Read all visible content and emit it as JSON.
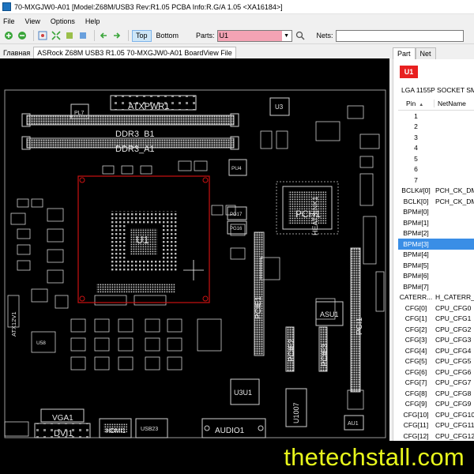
{
  "window": {
    "title": "70-MXGJW0-A01 [Model:Z68M/USB3 Rev:R1.05 PCBA Info:R.G/A 1.05     <XA16184>]"
  },
  "menu": [
    "File",
    "View",
    "Options",
    "Help"
  ],
  "toolbar": {
    "top_label": "Top",
    "bottom_label": "Bottom",
    "parts_label": "Parts:",
    "parts_value": "U1",
    "nets_label": "Nets:",
    "nets_value": ""
  },
  "doc_tabs": [
    "Главная",
    "ASRock Z68M USB3 R1.05 70-MXGJW0-A01 BoardView File"
  ],
  "board": {
    "labels": [
      {
        "id": "atxpwr",
        "text": "ATXPWR1"
      },
      {
        "id": "ddr_b1",
        "text": "DDR3_B1"
      },
      {
        "id": "ddr_a1",
        "text": "DDR3_A1"
      },
      {
        "id": "pl7",
        "text": "PL7"
      },
      {
        "id": "u3",
        "text": "U3"
      },
      {
        "id": "u1",
        "text": "U1"
      },
      {
        "id": "pch",
        "text": "PCH1"
      },
      {
        "id": "heatsink",
        "text": "HEATSINK1"
      },
      {
        "id": "pcie1",
        "text": "PCIE1"
      },
      {
        "id": "pcie2",
        "text": "PCIE2"
      },
      {
        "id": "pcie3",
        "text": "PCIE3"
      },
      {
        "id": "pci1",
        "text": "PCI1"
      },
      {
        "id": "asu1",
        "text": "ASU1"
      },
      {
        "id": "u3u1",
        "text": "U3U1"
      },
      {
        "id": "u1007",
        "text": "U1007"
      },
      {
        "id": "vga1",
        "text": "VGA1"
      },
      {
        "id": "dvi1",
        "text": "DVI1"
      },
      {
        "id": "hdmi1",
        "text": "HDMI1"
      },
      {
        "id": "usb23",
        "text": "USB23"
      },
      {
        "id": "audio1",
        "text": "AUDIO1"
      },
      {
        "id": "atx12v",
        "text": "ATX12V1"
      },
      {
        "id": "u58",
        "text": "U58"
      },
      {
        "id": "pu4",
        "text": "PU4"
      },
      {
        "id": "pg17",
        "text": "PG17"
      },
      {
        "id": "pg16",
        "text": "PG16"
      },
      {
        "id": "au1",
        "text": "AU1"
      }
    ]
  },
  "side": {
    "tabs": [
      "Part",
      "Net"
    ],
    "part_name": "U1",
    "part_desc": "LGA 1155P SOCKET SMT",
    "col_pin": "Pin",
    "col_netname": "NetName",
    "rows": [
      {
        "pin": "1",
        "net": ""
      },
      {
        "pin": "2",
        "net": ""
      },
      {
        "pin": "3",
        "net": ""
      },
      {
        "pin": "4",
        "net": ""
      },
      {
        "pin": "5",
        "net": ""
      },
      {
        "pin": "6",
        "net": ""
      },
      {
        "pin": "7",
        "net": ""
      },
      {
        "pin": "BCLK#[0]",
        "net": "PCH_CK_DMI"
      },
      {
        "pin": "BCLK[0]",
        "net": "PCH_CK_DMI"
      },
      {
        "pin": "BPM#[0]",
        "net": ""
      },
      {
        "pin": "BPM#[1]",
        "net": ""
      },
      {
        "pin": "BPM#[2]",
        "net": ""
      },
      {
        "pin": "BPM#[3]",
        "net": ""
      },
      {
        "pin": "BPM#[4]",
        "net": ""
      },
      {
        "pin": "BPM#[5]",
        "net": ""
      },
      {
        "pin": "BPM#[6]",
        "net": ""
      },
      {
        "pin": "BPM#[7]",
        "net": ""
      },
      {
        "pin": "CATERR...",
        "net": "H_CATERR_N"
      },
      {
        "pin": "CFG[0]",
        "net": "CPU_CFG0"
      },
      {
        "pin": "CFG[1]",
        "net": "CPU_CFG1"
      },
      {
        "pin": "CFG[2]",
        "net": "CPU_CFG2"
      },
      {
        "pin": "CFG[3]",
        "net": "CPU_CFG3"
      },
      {
        "pin": "CFG[4]",
        "net": "CPU_CFG4"
      },
      {
        "pin": "CFG[5]",
        "net": "CPU_CFG5"
      },
      {
        "pin": "CFG[6]",
        "net": "CPU_CFG6"
      },
      {
        "pin": "CFG[7]",
        "net": "CPU_CFG7"
      },
      {
        "pin": "CFG[8]",
        "net": "CPU_CFG8"
      },
      {
        "pin": "CFG[9]",
        "net": "CPU_CFG9"
      },
      {
        "pin": "CFG[10]",
        "net": "CPU_CFG10"
      },
      {
        "pin": "CFG[11]",
        "net": "CPU_CFG11"
      },
      {
        "pin": "CFG[12]",
        "net": "CPU_CFG12"
      }
    ],
    "selected_pin": "BPM#[3]"
  },
  "watermark": "thetechstall.com",
  "colors": {
    "selection": "#3a8ee6",
    "parts_field": "#f4a3b4",
    "part_button": "#e82020",
    "watermark": "#e8f71c",
    "highlight_box": "#cc1111"
  }
}
